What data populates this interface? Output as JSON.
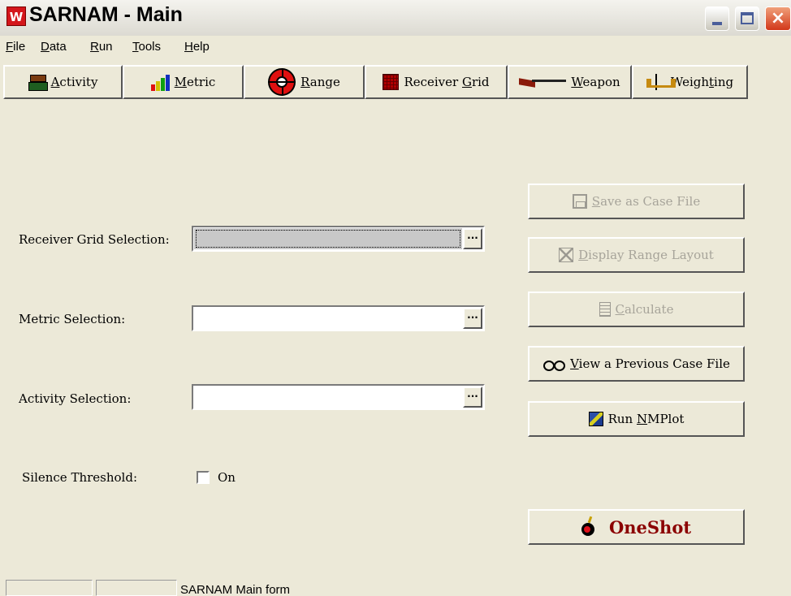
{
  "window": {
    "title": "SARNAM - Main",
    "icon_letter": "W",
    "controls": {
      "minimize": "minimize-icon",
      "maximize": "maximize-icon",
      "close": "×"
    }
  },
  "menu": [
    {
      "pre": "",
      "key": "F",
      "post": "ile"
    },
    {
      "pre": "",
      "key": "D",
      "post": "ata"
    },
    {
      "pre": "",
      "key": "R",
      "post": "un"
    },
    {
      "pre": "",
      "key": "T",
      "post": "ools"
    },
    {
      "pre": "",
      "key": "H",
      "post": "elp"
    }
  ],
  "toolbar": [
    {
      "icon": "activity-icon",
      "pre": "",
      "key": "A",
      "post": "ctivity"
    },
    {
      "icon": "metric-icon",
      "pre": "",
      "key": "M",
      "post": "etric"
    },
    {
      "icon": "range-icon",
      "pre": "",
      "key": "R",
      "post": "ange"
    },
    {
      "icon": "receiver-grid-icon",
      "pre": "Receiver ",
      "key": "G",
      "post": "rid"
    },
    {
      "icon": "weapon-icon",
      "pre": "",
      "key": "W",
      "post": "eapon"
    },
    {
      "icon": "weighting-icon",
      "pre": "Weigh",
      "key": "t",
      "post": "ing"
    }
  ],
  "form": {
    "receiver_grid_label": "Receiver Grid Selection:",
    "receiver_grid_value": "",
    "metric_label": "Metric Selection:",
    "metric_value": "",
    "activity_label": "Activity Selection:",
    "activity_value": "",
    "browse_label": "...",
    "silence_label": "Silence Threshold:",
    "silence_checkbox_label": "On",
    "silence_checked": false
  },
  "actions": {
    "save_case": {
      "pre": "",
      "key": "S",
      "post": "ave as Case File",
      "enabled": false,
      "icon": "save-icon"
    },
    "display_range": {
      "pre": "",
      "key": "D",
      "post": "isplay Range Layout",
      "enabled": false,
      "icon": "display-layout-icon"
    },
    "calculate": {
      "pre": "",
      "key": "C",
      "post": "alculate",
      "enabled": false,
      "icon": "calculator-icon"
    },
    "view_previous": {
      "pre": "",
      "key": "V",
      "post": "iew a Previous Case File",
      "enabled": true,
      "icon": "glasses-icon"
    },
    "run_nmplot": {
      "pre": "Run ",
      "key": "N",
      "post": "MPlot",
      "enabled": true,
      "icon": "nmplot-icon"
    },
    "oneshot": {
      "label": "OneShot",
      "enabled": true,
      "icon": "bomb-icon"
    }
  },
  "status": {
    "panel1": "",
    "panel2": "",
    "message": "SARNAM Main form"
  },
  "colors": {
    "face": "#ece9d8",
    "oneshot_text": "#8b0000",
    "disabled_text": "#a7a49a"
  }
}
